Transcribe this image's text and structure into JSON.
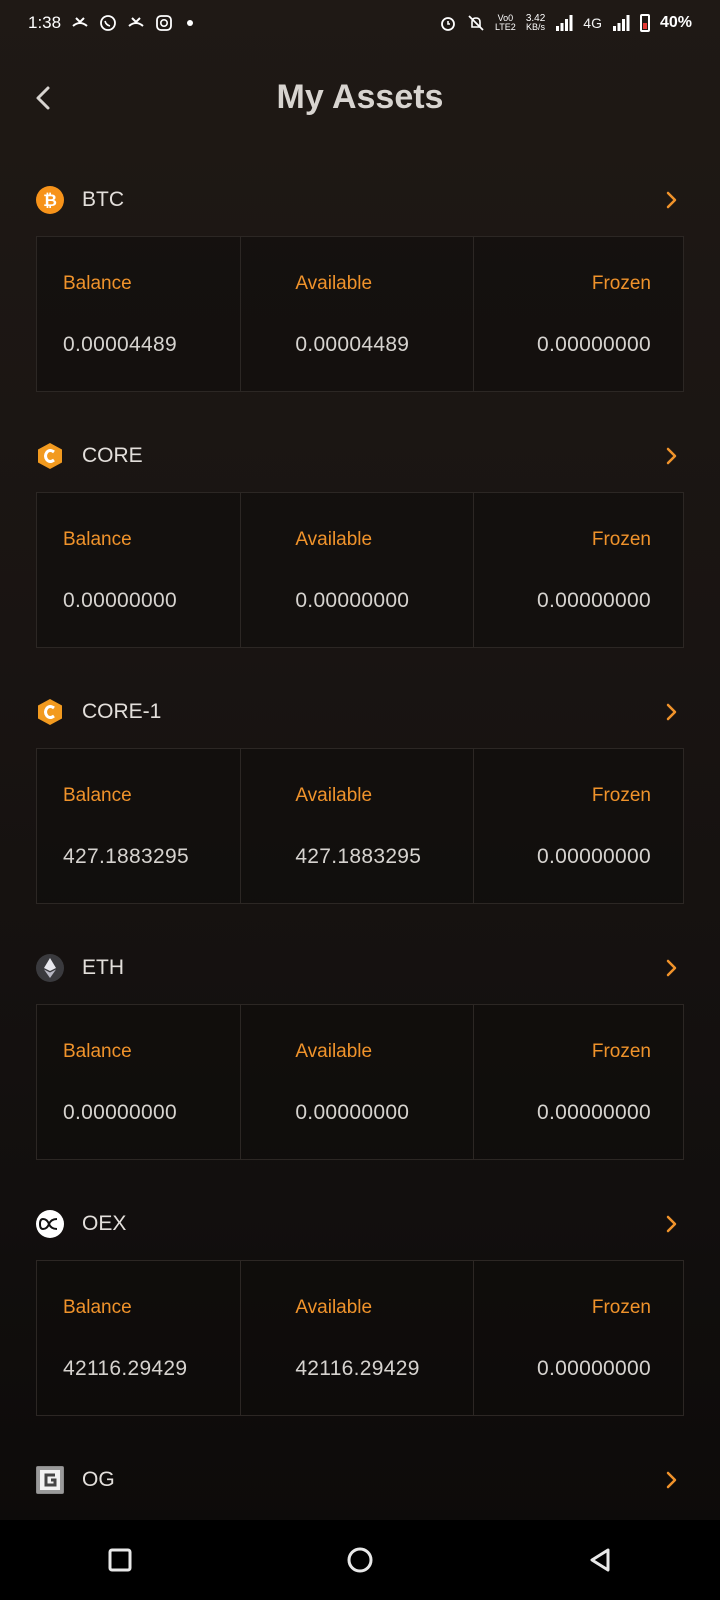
{
  "status_bar": {
    "time": "1:38",
    "data_speed_value": "3.42",
    "data_speed_unit": "KB/s",
    "volte": "Vo0",
    "lte": "LTE2",
    "network": "4G",
    "battery": "40%"
  },
  "header": {
    "title": "My Assets"
  },
  "colors": {
    "accent": "#f0932b",
    "background": "#1a1513",
    "card_border": "#2c2724"
  },
  "assets": [
    {
      "name": "BTC",
      "icon": "bitcoin-icon",
      "balance_label": "Balance",
      "available_label": "Available",
      "frozen_label": "Frozen",
      "balance": "0.00004489",
      "available": "0.00004489",
      "frozen": "0.00000000"
    },
    {
      "name": "CORE",
      "icon": "core-icon",
      "balance_label": "Balance",
      "available_label": "Available",
      "frozen_label": "Frozen",
      "balance": "0.00000000",
      "available": "0.00000000",
      "frozen": "0.00000000"
    },
    {
      "name": "CORE-1",
      "icon": "core-icon",
      "balance_label": "Balance",
      "available_label": "Available",
      "frozen_label": "Frozen",
      "balance": "427.1883295",
      "available": "427.1883295",
      "frozen": "0.00000000"
    },
    {
      "name": "ETH",
      "icon": "ethereum-icon",
      "balance_label": "Balance",
      "available_label": "Available",
      "frozen_label": "Frozen",
      "balance": "0.00000000",
      "available": "0.00000000",
      "frozen": "0.00000000"
    },
    {
      "name": "OEX",
      "icon": "oex-icon",
      "balance_label": "Balance",
      "available_label": "Available",
      "frozen_label": "Frozen",
      "balance": "42116.29429",
      "available": "42116.29429",
      "frozen": "0.00000000"
    },
    {
      "name": "OG",
      "icon": "og-icon"
    }
  ]
}
